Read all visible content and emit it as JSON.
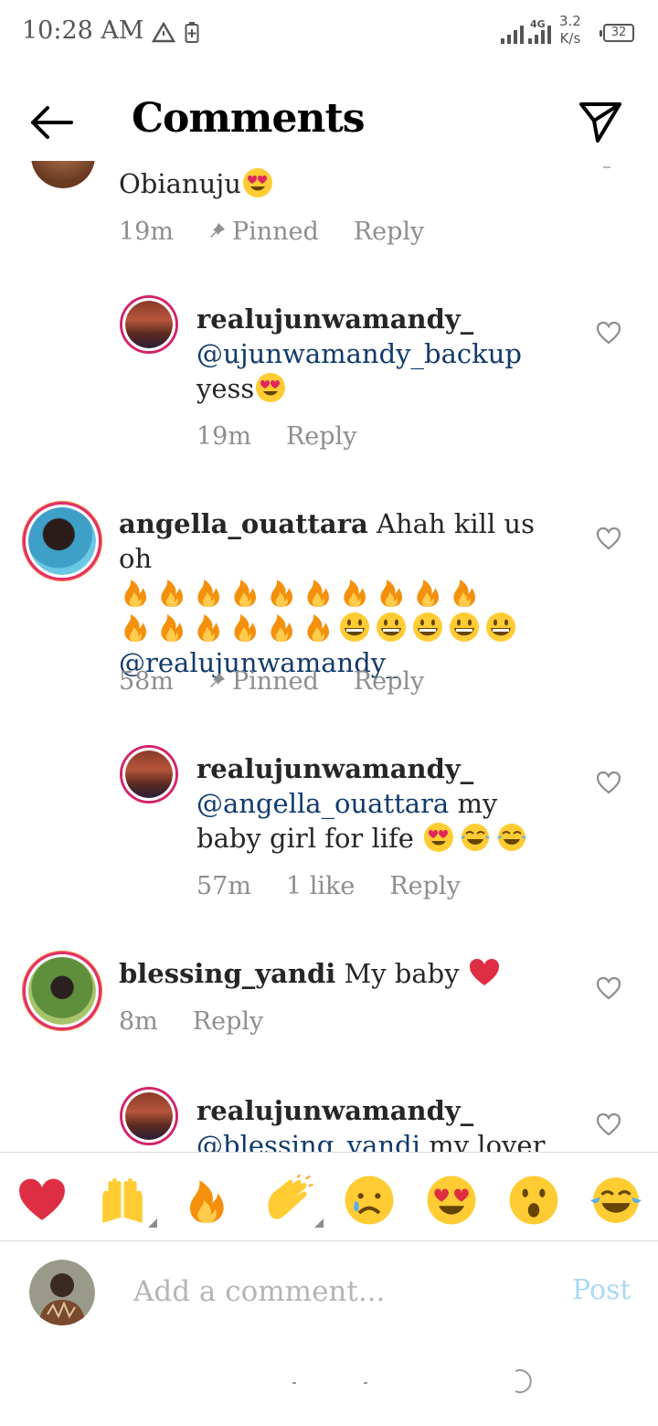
{
  "status_bar": {
    "time": "10:28 AM",
    "network": "4G",
    "speed_value": "3.2",
    "speed_unit": "K/s",
    "battery": "32"
  },
  "header": {
    "title": "Comments"
  },
  "comments": [
    {
      "id": "c0",
      "text": "Obianuju",
      "time": "19m",
      "pinned_label": "Pinned",
      "reply_label": "Reply"
    },
    {
      "id": "r1",
      "username": "realujunwamandy_",
      "mention": "@ujunwamandy_backup",
      "text": "yess",
      "time": "19m",
      "reply_label": "Reply"
    },
    {
      "id": "c2",
      "username": "angella_ouattara",
      "text": "Ahah kill us oh",
      "mention": "@realujunwamandy_",
      "time": "58m",
      "pinned_label": "Pinned",
      "reply_label": "Reply"
    },
    {
      "id": "r3",
      "username": "realujunwamandy_",
      "mention": "@angella_ouattara",
      "text_after": "my",
      "text_line2": "baby girl for life",
      "time": "57m",
      "likes": "1 like",
      "reply_label": "Reply"
    },
    {
      "id": "c4",
      "username": "blessing_yandi",
      "text": "My baby",
      "time": "8m",
      "reply_label": "Reply"
    },
    {
      "id": "r5",
      "username": "realujunwamandy_",
      "mention": "@blessing_yandi",
      "text_after": "my lover"
    }
  ],
  "reactions": [
    "red-heart",
    "raising-hands",
    "fire",
    "clapping-hands",
    "crying-face",
    "heart-eyes-face",
    "surprised-face",
    "tears-of-joy-face"
  ],
  "composer": {
    "placeholder": "Add a comment...",
    "post_label": "Post"
  },
  "colors": {
    "accent": "#103a6b",
    "meta": "#8e8e8e",
    "post_disabled": "#a9d9f7",
    "ring": "#d3246b"
  }
}
